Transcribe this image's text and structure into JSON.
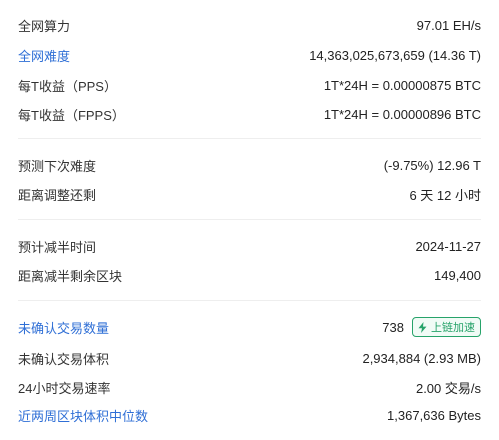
{
  "rows_group1": [
    {
      "label": "全网算力",
      "value": "97.01 EH/s",
      "link": false
    },
    {
      "label": "全网难度",
      "value": "14,363,025,673,659 (14.36 T)",
      "link": true
    },
    {
      "label": "每T收益（PPS）",
      "value": "1T*24H = 0.00000875 BTC",
      "link": false
    },
    {
      "label": "每T收益（FPPS）",
      "value": "1T*24H = 0.00000896 BTC",
      "link": false
    }
  ],
  "rows_group2": [
    {
      "label": "预测下次难度",
      "value": "(-9.75%) 12.96 T"
    },
    {
      "label": "距离调整还剩",
      "value": "6 天 12 小时"
    }
  ],
  "rows_group3": [
    {
      "label": "预计减半时间",
      "value": "2024-11-27"
    },
    {
      "label": "距离减半剩余区块",
      "value": "149,400"
    }
  ],
  "rows_group4": {
    "unconfirmed_count": {
      "label": "未确认交易数量",
      "value": "738",
      "badge": "上链加速"
    },
    "unconfirmed_size": {
      "label": "未确认交易体积",
      "value": "2,934,884 (2.93 MB)"
    },
    "tx_rate": {
      "label": "24小时交易速率",
      "value": "2.00 交易/s"
    },
    "median_block": {
      "label": "近两周区块体积中位数",
      "value": "1,367,636 Bytes"
    }
  },
  "colors": {
    "link": "#2f6fd6",
    "accent_green": "#27a36a"
  }
}
